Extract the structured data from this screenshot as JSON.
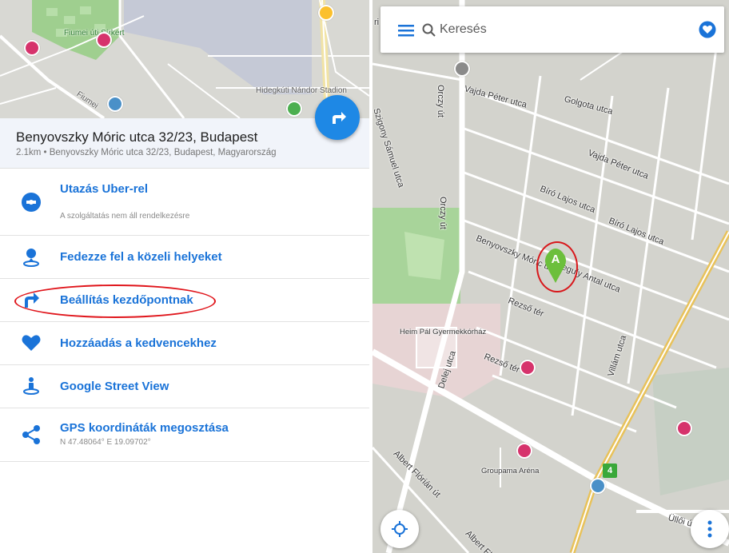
{
  "left_panel": {
    "map": {
      "labels": {
        "park_label": "Fiumei úti Sírkert",
        "stadium_label": "Hidegkúti Nándor Stadion",
        "street_label": "Fiumei"
      }
    },
    "address": {
      "title": "Benyovszky Móric utca 32/23, Budapest",
      "subtitle": "2.1km • Benyovszky Móric utca 32/23, Budapest, Magyarország"
    },
    "menu": [
      {
        "label": "Utazás Uber-rel",
        "sub": "A szolgáltatás nem áll rendelkezésre",
        "icon": "uber-icon"
      },
      {
        "label": "Fedezze fel a közeli helyeket",
        "sub": "",
        "icon": "explore-person-pin-icon"
      },
      {
        "label": "Beállítás kezdőpontnak",
        "sub": "",
        "icon": "set-start-arrow-icon"
      },
      {
        "label": "Hozzáadás a kedvencekhez",
        "sub": "",
        "icon": "heart-icon"
      },
      {
        "label": "Google Street View",
        "sub": "",
        "icon": "street-view-icon"
      },
      {
        "label": "GPS koordináták megosztása",
        "sub": "N 47.48064° E 19.09702°",
        "icon": "share-icon"
      }
    ]
  },
  "right_panel": {
    "search": {
      "placeholder": "Keresés"
    },
    "streets": {
      "orczy_top": "Orczy út",
      "orczy_mid": "Orczy út",
      "vajda1": "Vajda Péter utca",
      "vajda2": "Vajda Péter utca",
      "golgota": "Golgota utca",
      "szamuel": "Szigony Sámuel utca",
      "biro1": "Bíró Lajos utca",
      "biro2": "Bíró Lajos utca",
      "benyovszky": "Benyovszky Móric utca",
      "reguly": "Reguly Antal utca",
      "rezso1": "Rezső tér",
      "rezso2": "Rezső tér",
      "heim": "Heim Pál Gyermekkórház",
      "delej": "Delej utca",
      "villam": "Villám utca",
      "albert1": "Albert Flórián út",
      "albert2": "Albert Fló",
      "groupama": "Groupama Aréna",
      "ulloi": "Üllői út",
      "corner": "ri"
    },
    "marker": {
      "letter": "A"
    },
    "route_badge": "4"
  },
  "colors": {
    "accent": "#1e88e5",
    "menu_text": "#1a73d8",
    "highlight": "#e0161c",
    "marker_green": "#6cbf3c",
    "poi_pink": "#d6336c",
    "tram_line": "#e8c25a"
  }
}
